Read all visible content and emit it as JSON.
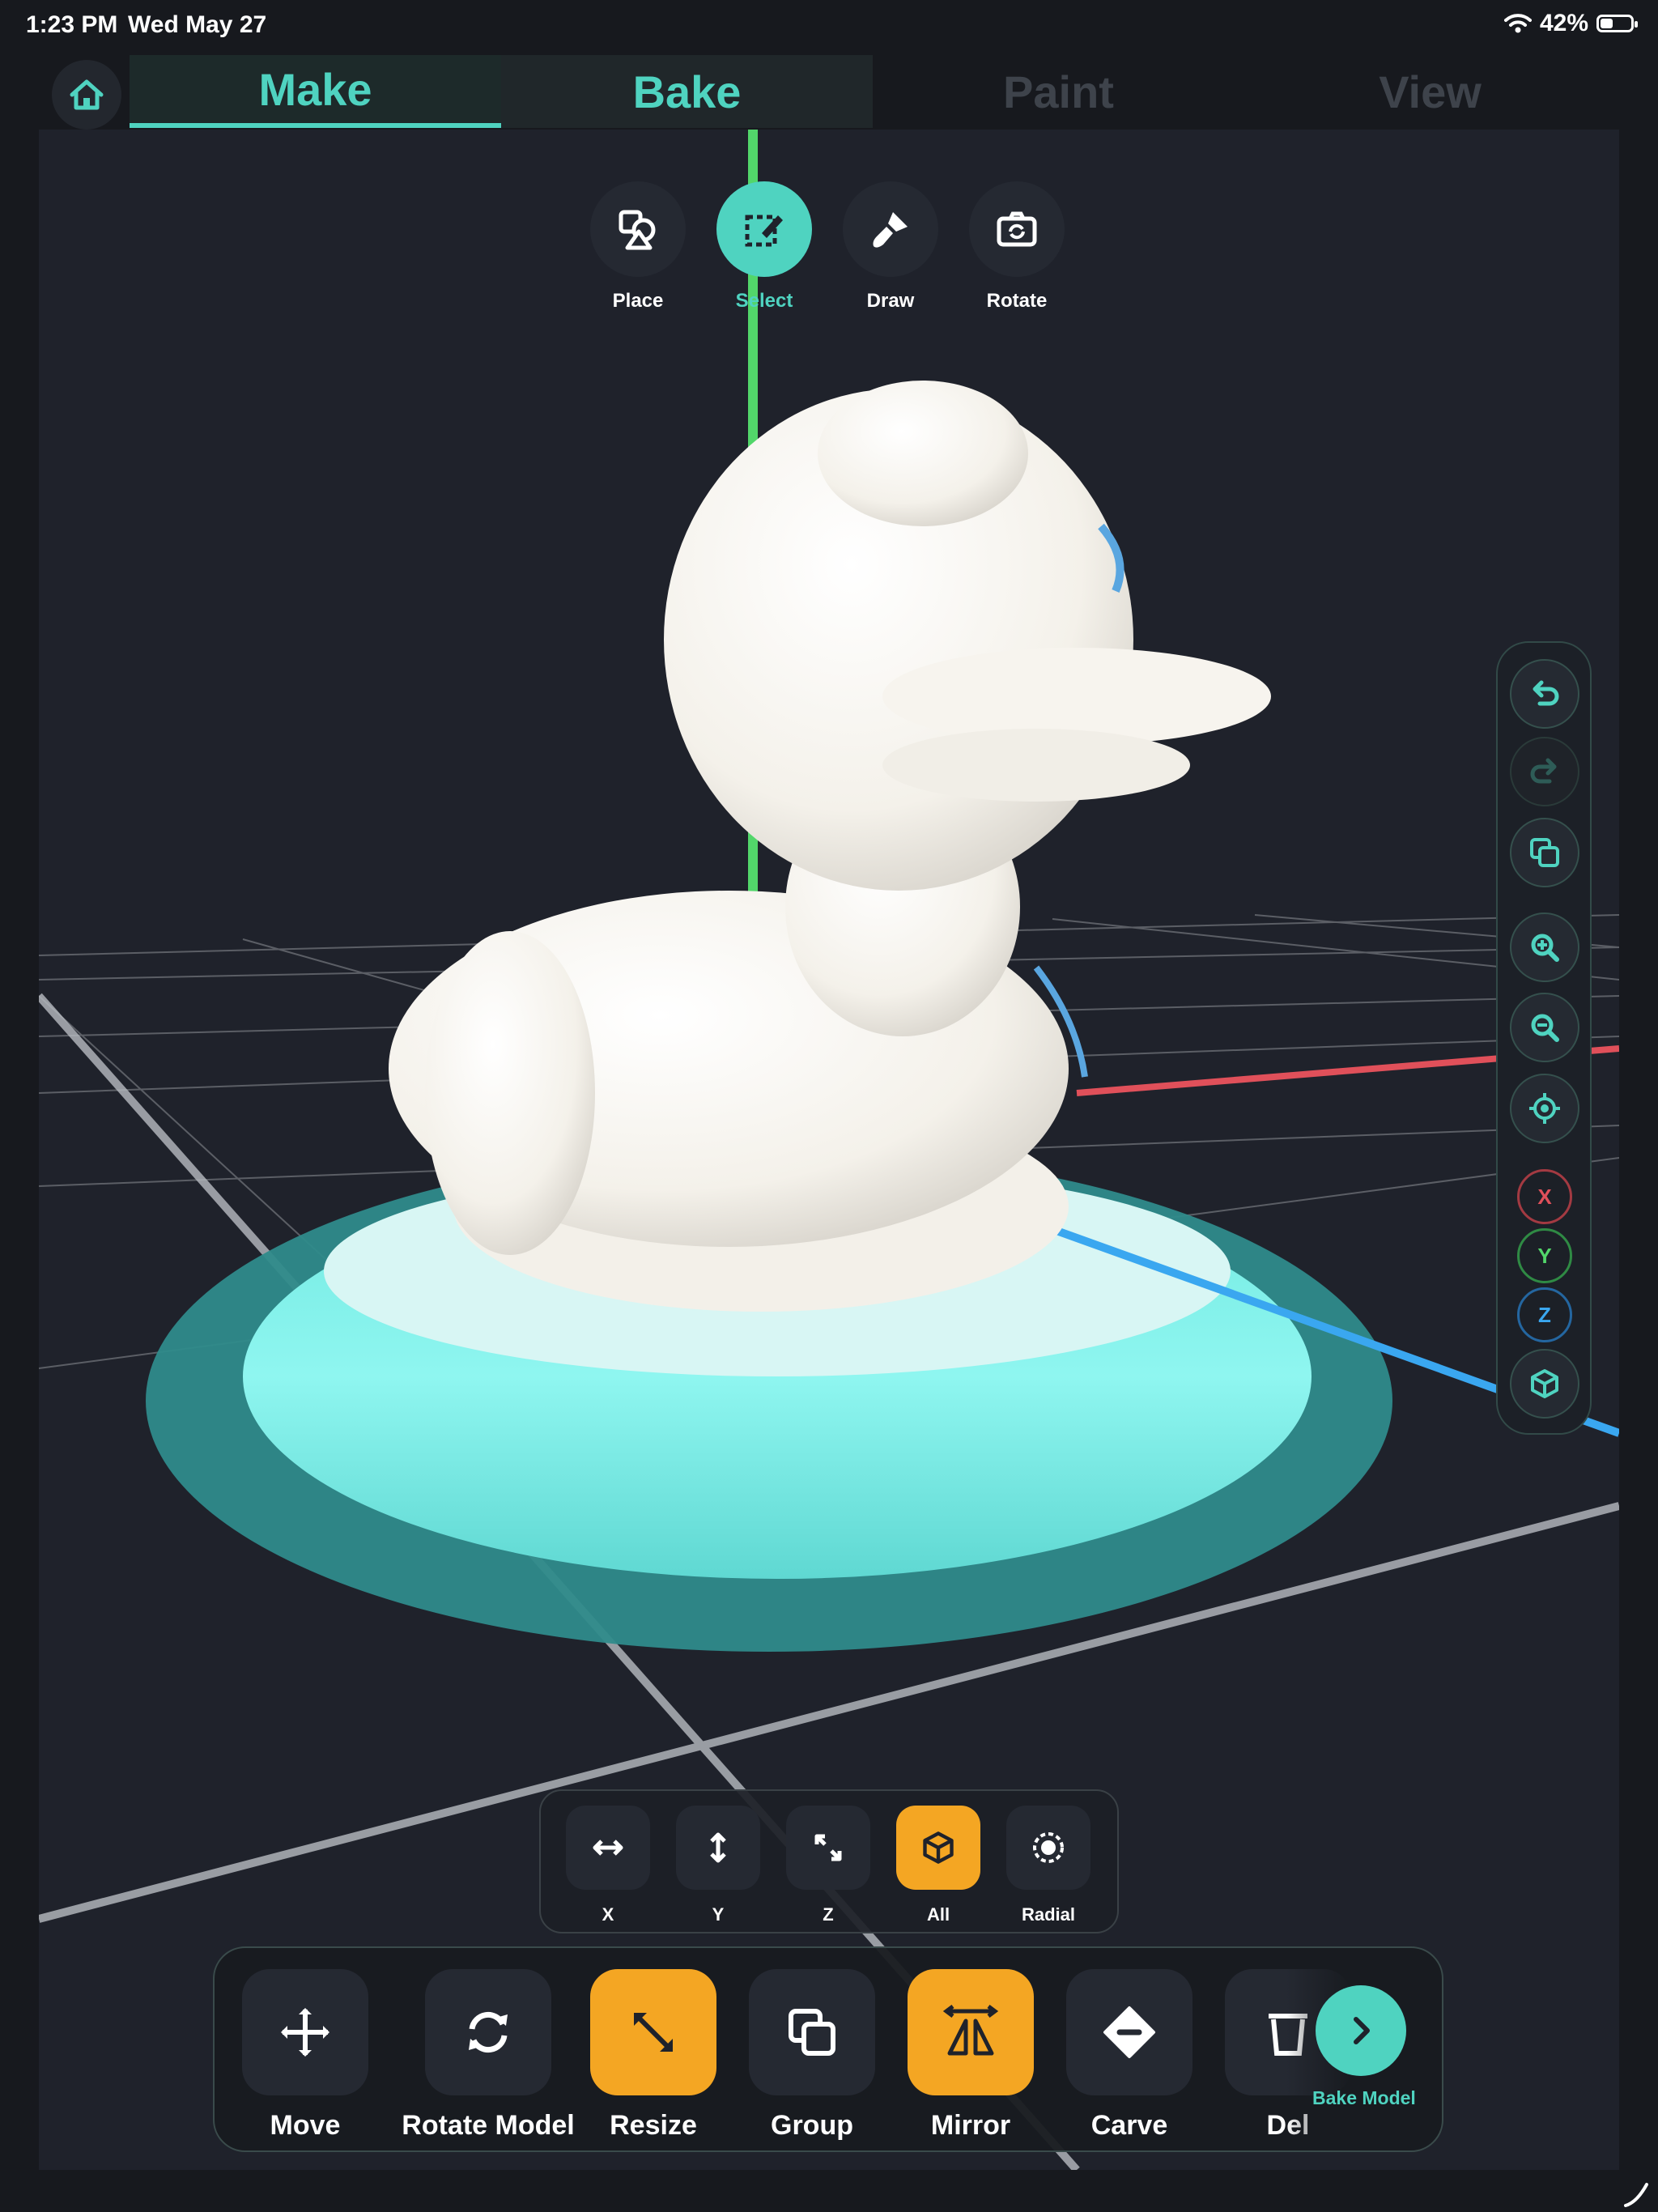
{
  "status_bar": {
    "time": "1:23 PM",
    "date": "Wed May 27",
    "battery": "42%",
    "battery_level": 0.42
  },
  "tabs": [
    {
      "label": "Make",
      "state": "active"
    },
    {
      "label": "Bake",
      "state": "enabled"
    },
    {
      "label": "Paint",
      "state": "disabled"
    },
    {
      "label": "View",
      "state": "disabled"
    }
  ],
  "modes": [
    {
      "label": "Place",
      "icon": "place-icon"
    },
    {
      "label": "Select",
      "icon": "select-icon",
      "active": true
    },
    {
      "label": "Draw",
      "icon": "draw-brush-icon"
    },
    {
      "label": "Rotate",
      "icon": "camera-rotate-icon"
    }
  ],
  "side_controls": {
    "buttons": [
      "undo-icon",
      "redo-icon",
      "duplicate-icon",
      "zoom-in-icon",
      "zoom-out-icon",
      "recenter-icon"
    ],
    "axes": [
      "X",
      "Y",
      "Z"
    ],
    "view_button": "cube-view-icon"
  },
  "axis_options": [
    {
      "label": "X",
      "icon": "horizontal-arrows-icon"
    },
    {
      "label": "Y",
      "icon": "vertical-arrows-icon"
    },
    {
      "label": "Z",
      "icon": "diagonal-arrows-icon"
    },
    {
      "label": "All",
      "icon": "cube-icon",
      "active": true
    },
    {
      "label": "Radial",
      "icon": "radial-icon"
    }
  ],
  "tools": [
    {
      "label": "Move",
      "icon": "move-icon"
    },
    {
      "label": "Rotate Model",
      "icon": "rotate-icon"
    },
    {
      "label": "Resize",
      "icon": "resize-icon",
      "active": true
    },
    {
      "label": "Group",
      "icon": "group-icon"
    },
    {
      "label": "Mirror",
      "icon": "mirror-icon",
      "active": true
    },
    {
      "label": "Carve",
      "icon": "carve-icon"
    },
    {
      "label": "Del",
      "icon": "delete-icon"
    }
  ],
  "bake_model": {
    "label": "Bake Model",
    "icon": "chevron-right-icon"
  },
  "colors": {
    "accent": "#4fd3c0",
    "highlight": "#f4a623",
    "background": "#1f222b",
    "axis_x": "#e0505a",
    "axis_y": "#52d66a",
    "axis_z": "#3aa7f0"
  }
}
